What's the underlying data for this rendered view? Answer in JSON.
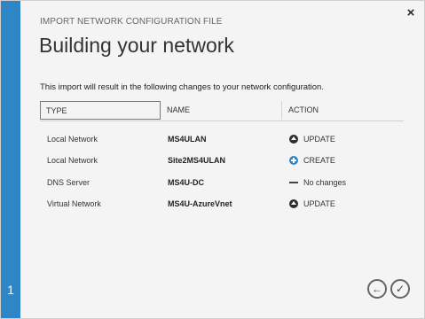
{
  "dialog": {
    "subtitle": "IMPORT NETWORK CONFIGURATION FILE",
    "title": "Building your network",
    "description": "This import will result in the following changes to your network configuration.",
    "close_glyph": "×",
    "step_number": "1"
  },
  "table": {
    "headers": {
      "type": "TYPE",
      "name": "NAME",
      "action": "ACTION"
    },
    "rows": [
      {
        "type": "Local Network",
        "name": "MS4ULAN",
        "action": "UPDATE",
        "icon": "update-icon"
      },
      {
        "type": "Local Network",
        "name": "Site2MS4ULAN",
        "action": "CREATE",
        "icon": "create-icon"
      },
      {
        "type": "DNS Server",
        "name": "MS4U-DC",
        "action": "No changes",
        "icon": "no-change-icon"
      },
      {
        "type": "Virtual Network",
        "name": "MS4U-AzureVnet",
        "action": "UPDATE",
        "icon": "update-icon"
      }
    ]
  },
  "nav": {
    "back_glyph": "←",
    "ok_glyph": "✓"
  },
  "colors": {
    "accent": "#2f86c6",
    "background": "#f4f4f4"
  }
}
